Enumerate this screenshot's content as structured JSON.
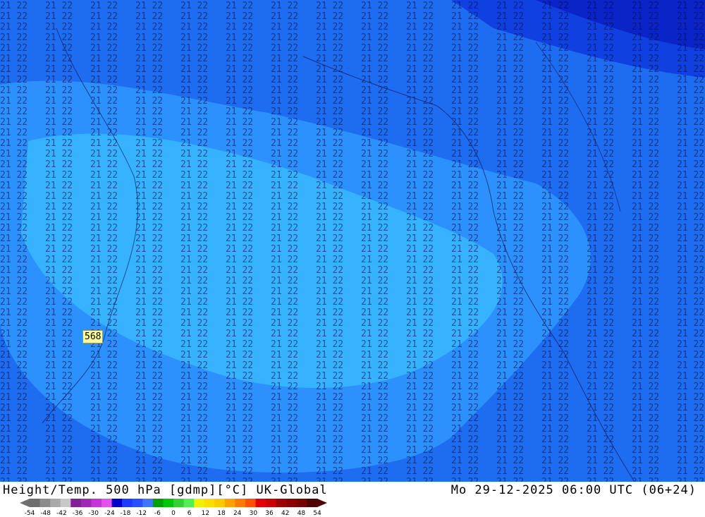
{
  "title": {
    "left": "Height/Temp. 500 hPa [gdmp][°C] UK-Global",
    "right": "Mo 29-12-2025 06:00 UTC (06+24)"
  },
  "station_label": "568",
  "colorbar": {
    "ticks": [
      "-54",
      "-48",
      "-42",
      "-36",
      "-30",
      "-24",
      "-18",
      "-12",
      "-6",
      "0",
      "6",
      "12",
      "18",
      "24",
      "30",
      "36",
      "42",
      "48",
      "54"
    ],
    "colors": [
      "#6e6e6e",
      "#8c8c8c",
      "#a9a9a9",
      "#c8c8c8",
      "#821e96",
      "#a028b4",
      "#c832dc",
      "#e650f0",
      "#0000c8",
      "#1e3cff",
      "#2850ff",
      "#3c78ff",
      "#00a000",
      "#00c800",
      "#32d232",
      "#50f050",
      "#f0f000",
      "#ffdc00",
      "#ffc800",
      "#ffa000",
      "#ff7800",
      "#ff5000",
      "#e10000",
      "#c80000",
      "#a00000",
      "#8c0000",
      "#780000",
      "#500000"
    ]
  },
  "map_icons": [
    "coastline-icon",
    "temperature-contour-icon"
  ]
}
